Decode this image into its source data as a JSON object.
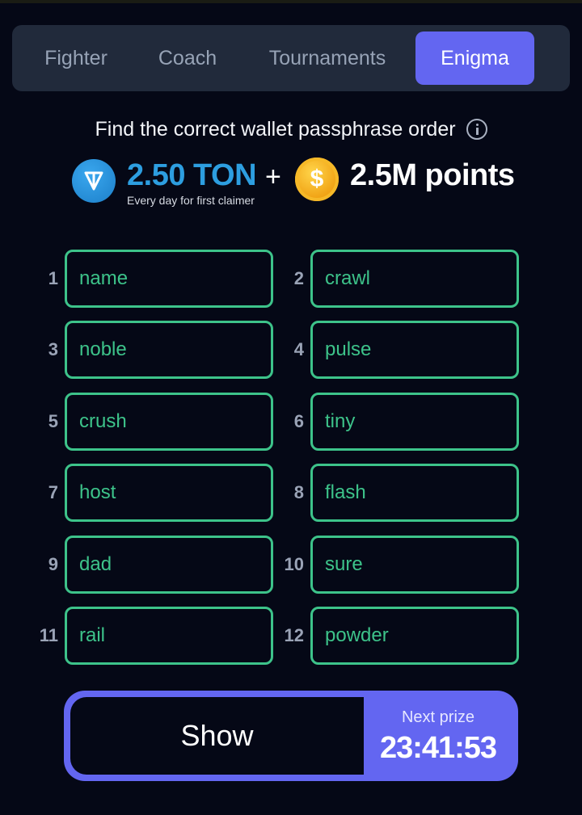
{
  "tabs": [
    {
      "label": "Fighter",
      "active": false
    },
    {
      "label": "Coach",
      "active": false
    },
    {
      "label": "Tournaments",
      "active": false
    },
    {
      "label": "Enigma",
      "active": true
    }
  ],
  "headline": {
    "text": "Find the correct wallet passphrase order",
    "info_icon": "info-circle-icon"
  },
  "reward": {
    "ton_icon": "ton-logo-icon",
    "ton_amount": "2.50 TON",
    "ton_subtitle": "Every day for first claimer",
    "plus": "+",
    "coin_icon": "dollar-coin-icon",
    "coin_symbol": "$",
    "points": "2.5M points"
  },
  "words": [
    {
      "index": "1",
      "word": "name"
    },
    {
      "index": "2",
      "word": "crawl"
    },
    {
      "index": "3",
      "word": "noble"
    },
    {
      "index": "4",
      "word": "pulse"
    },
    {
      "index": "5",
      "word": "crush"
    },
    {
      "index": "6",
      "word": "tiny"
    },
    {
      "index": "7",
      "word": "host"
    },
    {
      "index": "8",
      "word": "flash"
    },
    {
      "index": "9",
      "word": "dad"
    },
    {
      "index": "10",
      "word": "sure"
    },
    {
      "index": "11",
      "word": "rail"
    },
    {
      "index": "12",
      "word": "powder"
    }
  ],
  "action": {
    "show_label": "Show",
    "next_prize_label": "Next prize",
    "countdown": "23:41:53"
  },
  "colors": {
    "background": "#050816",
    "accent": "#6366f1",
    "word_green": "#3dc38a",
    "ton_blue": "#2d9ee0"
  }
}
